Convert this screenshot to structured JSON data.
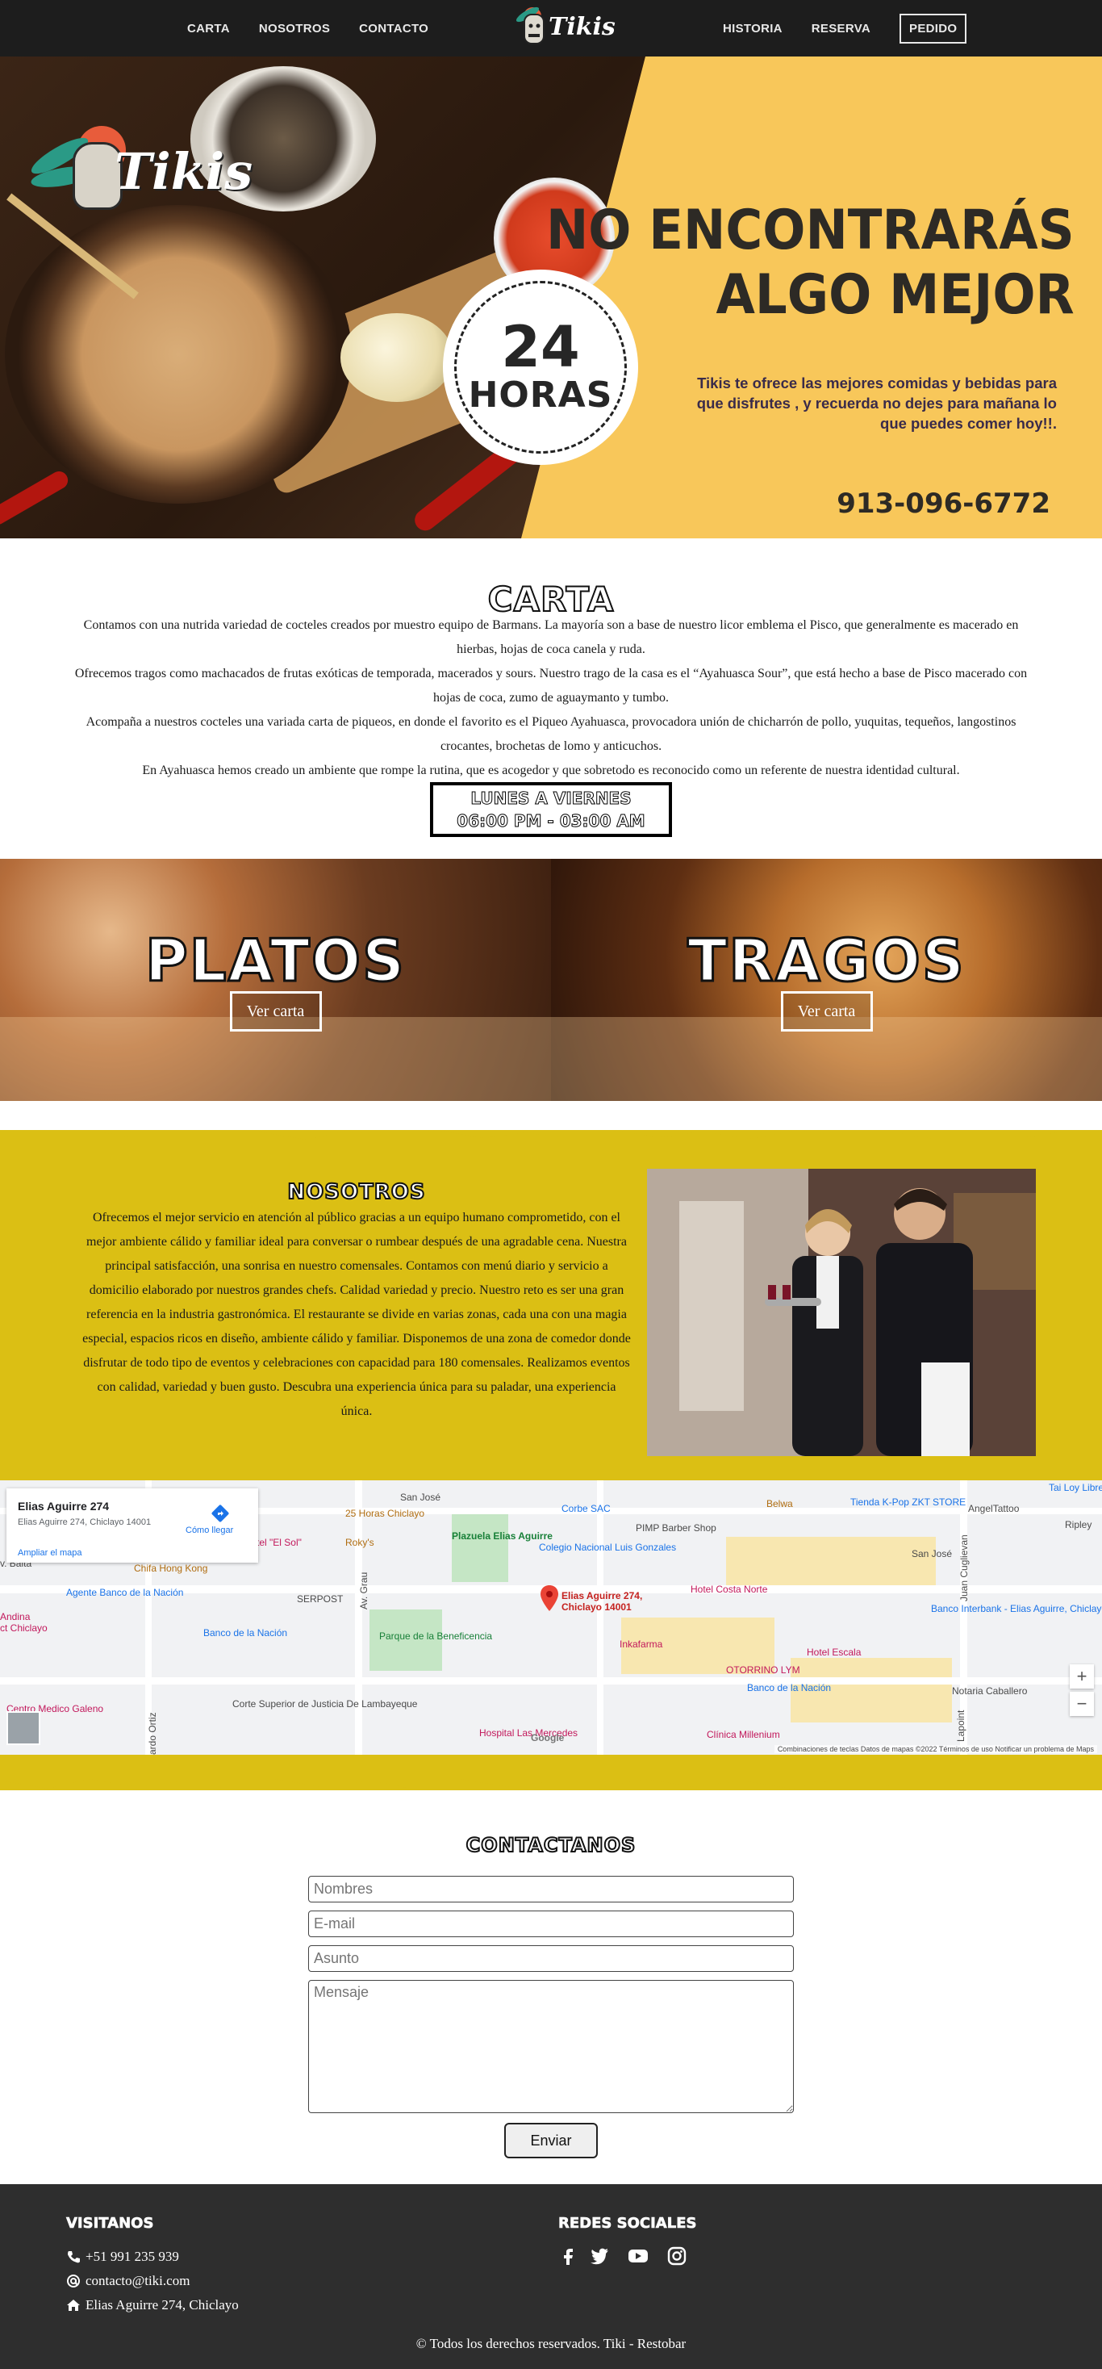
{
  "nav": {
    "left": [
      "CARTA",
      "NOSOTROS",
      "CONTACTO"
    ],
    "right": [
      "HISTORIA",
      "RESERVA"
    ],
    "button": "PEDIDO",
    "logo": "Tikis"
  },
  "hero": {
    "logo": "Tikis",
    "hours_num": "24",
    "hours_txt": "HORAS",
    "headline_1": "NO ENCONTRARÁS",
    "headline_2": "ALGO MEJOR",
    "subtitle": "Tikis te ofrece las mejores comidas y bebidas para que disfrutes , y recuerda no dejes para mañana lo que puedes comer hoy!!.",
    "phone": "913-096-6772"
  },
  "carta": {
    "title": "CARTA",
    "paragraphs": [
      "Contamos con una nutrida variedad de cocteles creados por muestro equipo de Barmans. La mayoría son a base de nuestro licor emblema el Pisco, que generalmente es macerado en hierbas, hojas de coca canela y ruda.",
      "Ofrecemos tragos como machacados de frutas exóticas de temporada, macerados y sours. Nuestro trago de la casa es el “Ayahuasca Sour”, que está hecho a base de Pisco macerado con hojas de coca, zumo de aguaymanto y tumbo.",
      "Acompaña a nuestros cocteles una variada carta de piqueos, en donde el favorito es el Piqueo Ayahuasca, provocadora unión de chicharrón de pollo, yuquitas, tequeños, langostinos crocantes, brochetas de lomo y anticuchos.",
      "En Ayahuasca hemos creado un ambiente que rompe la rutina, que es acogedor y que sobretodo es reconocido como un referente de nuestra identidad cultural."
    ],
    "hours_days": "LUNES A VIERNES",
    "hours_time": "06:00 PM - 03:00 AM"
  },
  "panels": {
    "platos": {
      "title": "PLATOS",
      "button": "Ver carta"
    },
    "tragos": {
      "title": "TRAGOS",
      "button": "Ver carta"
    }
  },
  "nosotros": {
    "title": "NOSOTROS",
    "text": "Ofrecemos el mejor servicio en atención al público gracias a un equipo humano comprometido, con el mejor ambiente cálido y familiar ideal para conversar o rumbear después de una agradable cena. Nuestra principal satisfacción, una sonrisa en nuestro comensales. Contamos con menú diario y servicio a domicilio elaborado por nuestros grandes chefs. Calidad variedad y precio. Nuestro reto es ser una gran referencia en la industria gastronómica. El restaurante se divide en varias zonas, cada una con una magia especial, espacios ricos en diseño, ambiente cálido y familiar. Disponemos de una zona de comedor donde disfrutar de todo tipo de eventos y celebraciones con capacidad para 180 comensales. Realizamos eventos con calidad, variedad y buen gusto. Descubra una experiencia única para su paladar, una experiencia única."
  },
  "map": {
    "place": "Elias Aguirre 274",
    "address": "Elias Aguirre 274, Chiclayo 14001",
    "directions": "Cómo llegar",
    "enlarge": "Ampliar el mapa",
    "pin_label_1": "Elias Aguirre 274,",
    "pin_label_2": "Chiclayo 14001",
    "labels": [
      "San José",
      "25 Horas Chiclayo",
      "Corbe SAC",
      "Belwa",
      "Tienda K-Pop ZKT STORE",
      "AngelTattoo",
      "Tai Loy Librería",
      "Ripley",
      "tel \"El Sol\"",
      "Roky's",
      "PIMP Barber Shop",
      "Plazuela Elias Aguirre",
      "Colegio Nacional Luis Gonzales",
      "San José",
      "Chifa Hong Kong",
      "Agente Banco de la Nación",
      "SERPOST",
      "Hotel Costa Norte",
      "Banco Interbank - Elias Aguirre, Chiclayo",
      "Banco de la Nación",
      "Parque de la Beneficencia",
      "Inkafarma",
      "Hotel Escala",
      "OTORRINO LYM",
      "Banco de la Nación",
      "Notaria Caballero",
      "Centro Medico Galeno",
      "Corte Superior de Justicia De Lambayeque",
      "Hospital Las Mercedes",
      "Clínica Millenium",
      "Av. Grau",
      "Juan Cuglievan",
      "Lapoint",
      "ardo Ortiz",
      "v. Balta",
      "Andina",
      "ct Chiclayo"
    ],
    "footer": "Combinaciones de teclas   Datos de mapas ©2022   Términos de uso   Notificar un problema de Maps",
    "zoom_in": "+",
    "zoom_out": "−",
    "google": "Google"
  },
  "contact": {
    "title": "CONTACTANOS",
    "fields": {
      "name": "Nombres",
      "email": "E-mail",
      "subject": "Asunto",
      "message": "Mensaje"
    },
    "send": "Enviar"
  },
  "footer": {
    "visit_title": "VISITANOS",
    "phone": "+51 991 235 939",
    "email": "contacto@tiki.com",
    "address": "Elias Aguirre 274, Chiclayo",
    "social_title": "REDES SOCIALES",
    "social": [
      "facebook-icon",
      "twitter-icon",
      "youtube-icon",
      "instagram-icon"
    ],
    "copyright": "© Todos los derechos reservados. Tiki - Restobar"
  }
}
